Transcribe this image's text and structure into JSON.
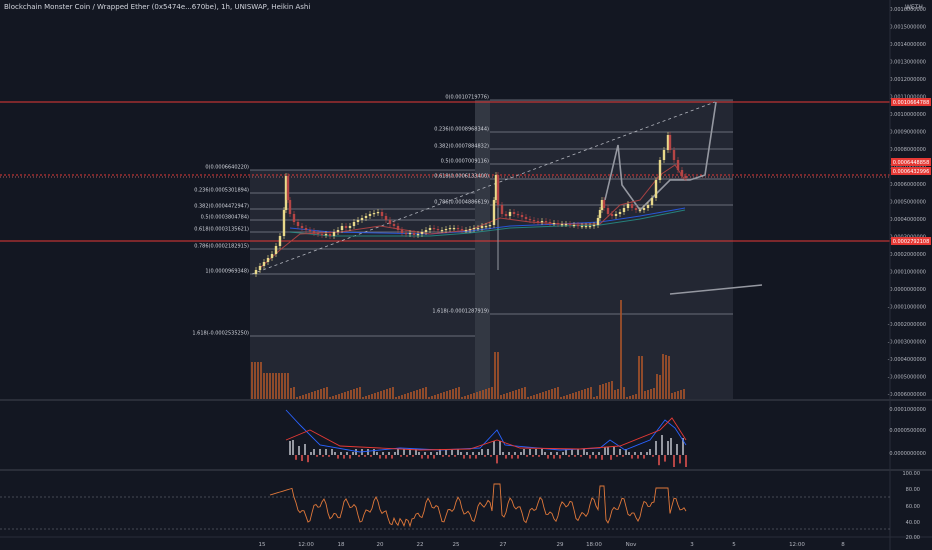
{
  "header": {
    "symbol_line": "Blockchain Monster Coin / Wrapped Ether (0x5474e...670be), 1h, UNISWAP, Heikin Ashi"
  },
  "top_right_label": "WETH",
  "colors": {
    "background": "#131722",
    "candle_up": "#e8d98a",
    "candle_down": "#b54545",
    "fib_line": "#b2b5be",
    "red_level": "#e53935",
    "volume": "#a3522a",
    "rsi": "#e0783a",
    "macd": "#2962ff"
  },
  "price_scale": {
    "labels": [
      "0.0016000000",
      "0.0015000000",
      "0.0014000000",
      "0.0013000000",
      "0.0012000000",
      "0.0011000000",
      "0.0010000000",
      "0.0009000000",
      "0.0008000000",
      "0.0007000000",
      "0.0006000000",
      "0.0005000000",
      "0.0004000000",
      "0.0003000000",
      "0.0002000000",
      "0.0001000000",
      "0.0000000000",
      "-0.0001000000",
      "-0.0002000000",
      "-0.0003000000",
      "-0.0004000000",
      "-0.0005000000",
      "-0.0006000000"
    ],
    "highlights": [
      {
        "text": "0.0010664788",
        "color": "#e53935"
      },
      {
        "text": "0.0006448858",
        "color": "#e53935"
      },
      {
        "text": "0.0006432996",
        "color": "#e53935"
      },
      {
        "text": "0.0002792108",
        "color": "#e53935"
      }
    ]
  },
  "fib_left": {
    "levels": [
      {
        "ratio": "0(0.0006640220)"
      },
      {
        "ratio": "0.236(0.0005301894)"
      },
      {
        "ratio": "0.382(0.0004472947)"
      },
      {
        "ratio": "0.5(0.0003804784)"
      },
      {
        "ratio": "0.618(0.0003135621)"
      },
      {
        "ratio": "0.786(0.0002182915)"
      },
      {
        "ratio": "1(0.0000969348)"
      },
      {
        "ratio": "1.618(-0.0002535250)"
      }
    ]
  },
  "fib_right": {
    "levels": [
      {
        "ratio": "0(0.0010719776)"
      },
      {
        "ratio": "0.236(0.0008968344)"
      },
      {
        "ratio": "0.382(0.0007884832)"
      },
      {
        "ratio": "0.5(0.0007009116)"
      },
      {
        "ratio": "0.618(0.0006133400)"
      },
      {
        "ratio": "0.786(0.0004886619)"
      },
      {
        "ratio": "1.618(-0.0001287919)"
      }
    ]
  },
  "macd_scale": [
    "0.0001000000",
    "0.0000500000",
    "0.0000000000"
  ],
  "rsi_scale": [
    "100.00",
    "80.00",
    "60.00",
    "40.00",
    "20.00"
  ],
  "time_axis": [
    "15",
    "12:00",
    "18",
    "20",
    "22",
    "25",
    "27",
    "29",
    "18:00",
    "Nov",
    "3",
    "5",
    "12:00",
    "8"
  ]
}
